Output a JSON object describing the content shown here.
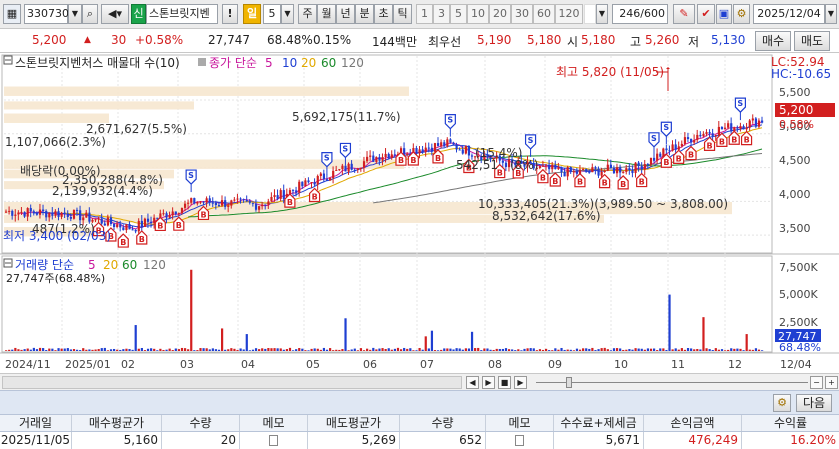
{
  "toolbar": {
    "code": "330730",
    "flag": "신",
    "name": "스톤브릿지벤",
    "excl": "!",
    "period_active": "일",
    "period_num": "5",
    "periods": [
      "주",
      "월",
      "년",
      "분",
      "초",
      "틱"
    ],
    "intervals": [
      "1",
      "3",
      "5",
      "10",
      "20",
      "30",
      "60",
      "120"
    ],
    "count": "246",
    "count_total": "/600",
    "date": "2025/12/04"
  },
  "quote": {
    "price": "5,200",
    "change": "30",
    "change_pct": "+0.58%",
    "volume": "27,747",
    "vol_ratio": "68.48%",
    "turnover": "0.15%",
    "amount": "144백만",
    "best": "최우선",
    "ask": "5,190",
    "bid": "5,180",
    "open_label": "시",
    "open": "5,180",
    "high_label": "고",
    "high": "5,260",
    "low_label": "저",
    "low": "5,130",
    "buy_btn": "매수",
    "sell_btn": "매도"
  },
  "price_panel": {
    "title": "스톤브릿지벤처스 매물대 수(10)",
    "ma_label": "종가 단순",
    "ma_periods": [
      "5",
      "10",
      "20",
      "60",
      "120"
    ],
    "ma_colors": [
      "#c8189c",
      "#1f3fd2",
      "#e0a800",
      "#1a8a2a",
      "#777777"
    ],
    "lc": "LC:52.94",
    "hc": "HC:-10.65",
    "max_label": "최고 5,820 (11/05)",
    "min_label": "최저 3,400 (02/03)",
    "dividend": "배당락(0.00%)",
    "current_price": "5,200",
    "current_pct": "0.58%",
    "y_ticks": [
      "5,500",
      "5,000",
      "4,500",
      "4,000",
      "3,500"
    ],
    "vp_labels": [
      "5,692,175(11.7%)",
      "2,671,627(5.5%)",
      "1,107,066(2.3%)",
      "2,350,288(4.8%)",
      "2,139,932(4.4%)",
      "10,333,405(21.3%)(3,989.50 ~ 3,808.00)",
      "8,532,642(17.6%)",
      "487(1.2%)",
      "(15.4%)",
      "542,51",
      "(8%)"
    ]
  },
  "volume_panel": {
    "title": "거래량 단순",
    "ma_periods": [
      "5",
      "20",
      "60",
      "120"
    ],
    "ma_colors": [
      "#c8189c",
      "#e0a800",
      "#1a8a2a",
      "#777777"
    ],
    "value": "27,747주(68.48%)",
    "y_ticks": [
      "7,500K",
      "5,000K",
      "2,500K"
    ],
    "current": "27,747",
    "current_pct": "68.48%"
  },
  "x_axis": [
    "2024/11",
    "2025/01",
    "02",
    "03",
    "04",
    "05",
    "06",
    "07",
    "08",
    "09",
    "10",
    "11",
    "12",
    "12/04"
  ],
  "trades": {
    "next_btn": "다음",
    "columns": [
      "거래일",
      "매수평균가",
      "수량",
      "메모",
      "매도평균가",
      "수량",
      "메모",
      "수수료+제세금",
      "손익금액",
      "수익률"
    ],
    "rows": [
      [
        "2025/11/05",
        "5,160",
        "20",
        "",
        "5,269",
        "652",
        "",
        "5,671",
        "476,249",
        "16.20%"
      ]
    ]
  },
  "chart_data": {
    "type": "candlestick",
    "x": [
      "2024/11",
      "2025/01",
      "02",
      "03",
      "04",
      "05",
      "06",
      "07",
      "08",
      "09",
      "10",
      "11",
      "12"
    ],
    "close": [
      3850,
      3820,
      3600,
      4000,
      3950,
      4350,
      4700,
      4850,
      4550,
      4420,
      4500,
      5000,
      5200
    ],
    "ylim": [
      3250,
      5900
    ],
    "volume_ylim": [
      0,
      7800000
    ]
  }
}
